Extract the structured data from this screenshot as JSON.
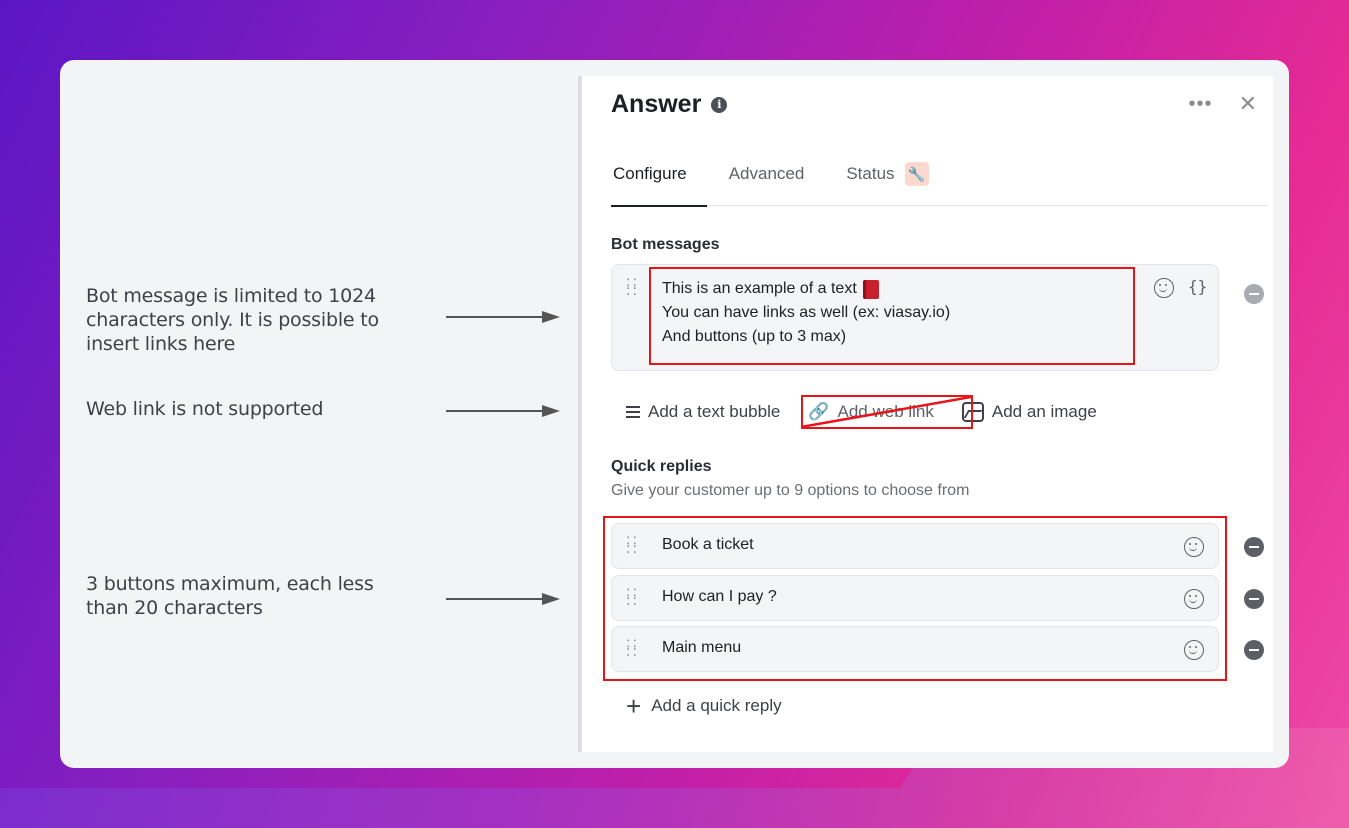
{
  "annotations": {
    "bot_message_note": [
      "Bot message is limited to 1024",
      "characters only. It is possible to",
      "insert links here"
    ],
    "web_link_note": "Web link is not supported",
    "buttons_note": [
      "3 buttons maximum, each less",
      "than 20 characters"
    ]
  },
  "panel": {
    "title": "Answer",
    "tabs": [
      {
        "label": "Configure",
        "active": true
      },
      {
        "label": "Advanced",
        "active": false
      },
      {
        "label": "Status",
        "active": false
      }
    ],
    "bot_messages": {
      "label": "Bot messages",
      "lines": [
        "This is an example of a text",
        "You can have links as well (ex: viasay.io)",
        "And buttons (up to 3 max)"
      ]
    },
    "add_actions": {
      "text_bubble": "Add a text bubble",
      "web_link": "Add web link",
      "image": "Add an image"
    },
    "quick_replies": {
      "label": "Quick replies",
      "description": "Give your customer up to 9 options to choose from",
      "items": [
        "Book a ticket",
        "How can I pay ?",
        "Main menu"
      ],
      "add_label": "Add a quick reply"
    }
  },
  "colors": {
    "highlight": "#e8141b",
    "accent_badge": "#fcd9cf"
  },
  "icons": [
    "info-icon",
    "more-icon",
    "close-icon",
    "wrench-icon",
    "drag-handle-icon",
    "emoji-icon",
    "variable-braces-icon",
    "remove-icon",
    "text-lines-icon",
    "link-icon",
    "image-icon",
    "plus-icon",
    "book-icon"
  ]
}
